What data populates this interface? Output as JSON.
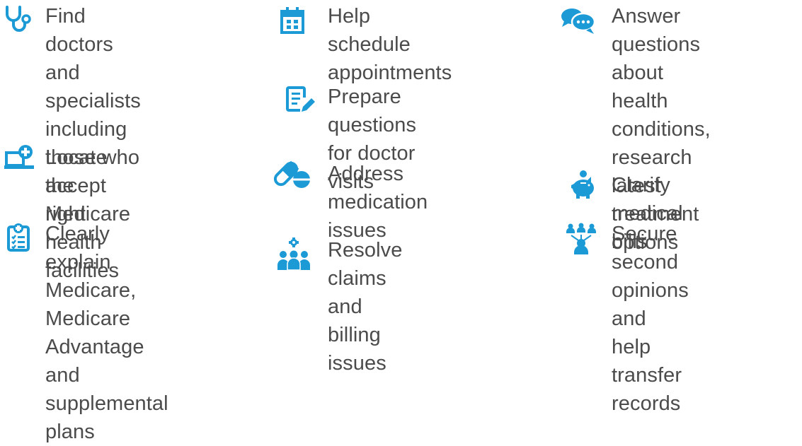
{
  "accent_color": "#1c9ad6",
  "items": [
    {
      "icon": "stethoscope-icon",
      "label": "Find doctors and\nspecialists including\nthose who accept\nMedicare"
    },
    {
      "icon": "laptop-medical-icon",
      "label": "Locate the right\nhealth facilities"
    },
    {
      "icon": "clipboard-checklist-icon",
      "label": "Clearly explain\nMedicare, Medicare\nAdvantage and\nsupplemental plans"
    },
    {
      "icon": "calendar-icon",
      "label": "Help schedule\nappointments"
    },
    {
      "icon": "notepad-pencil-icon",
      "label": "Prepare questions\nfor doctor visits"
    },
    {
      "icon": "pills-icon",
      "label": "Address medication\nissues"
    },
    {
      "icon": "team-gear-icon",
      "label": "Resolve claims and\nbilling issues"
    },
    {
      "icon": "chat-bubbles-icon",
      "label": "Answer questions\nabout health\nconditions, research\nlatest treatment\noptions"
    },
    {
      "icon": "piggy-bank-icon",
      "label": "Clarify medical bills"
    },
    {
      "icon": "people-network-icon",
      "label": "Secure second\nopinions and help\ntransfer records"
    }
  ]
}
